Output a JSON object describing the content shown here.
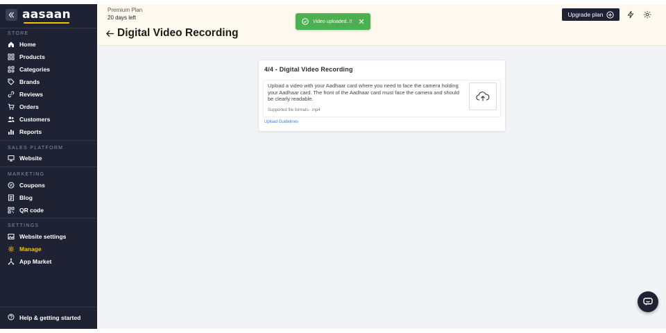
{
  "sidebar": {
    "logo": "aasaan",
    "sections": {
      "store": "STORE",
      "sales_platform": "SALES PLATFORM",
      "marketing": "MARKETING",
      "settings": "SETTINGS"
    },
    "items": {
      "home": "Home",
      "products": "Products",
      "categories": "Categories",
      "brands": "Brands",
      "reviews": "Reviews",
      "orders": "Orders",
      "customers": "Customers",
      "reports": "Reports",
      "website": "Website",
      "coupons": "Coupons",
      "blog": "Blog",
      "qr_code": "QR code",
      "website_settings": "Website settings",
      "manage": "Manage",
      "app_market": "App Market"
    },
    "active_item": "Manage",
    "help": "Help & getting started"
  },
  "topbar": {
    "plan_name": "Premium Plan",
    "plan_days": "20 days left",
    "page_title": "Digital Video Recording",
    "upgrade_label": "Upgrade plan"
  },
  "toast": {
    "message": "Video uploaded..!!"
  },
  "card": {
    "title": "4/4 - Digital Video Recording",
    "description": "Upload a video with your Aadhaar card where you need to face the camera holding your Aadhaar card. The front of the Aadhaar card must face the camera and should be clearly readable.",
    "formats": "Supported file formats- .mp4",
    "guidelines_link": "Upload Guidelines"
  },
  "colors": {
    "sidebar_bg": "#1f2233",
    "accent": "#f5c400",
    "success": "#4caf50",
    "link": "#3f7ad6",
    "topbar_bg": "#fdf9ee",
    "content_bg": "#f1f3f6"
  }
}
